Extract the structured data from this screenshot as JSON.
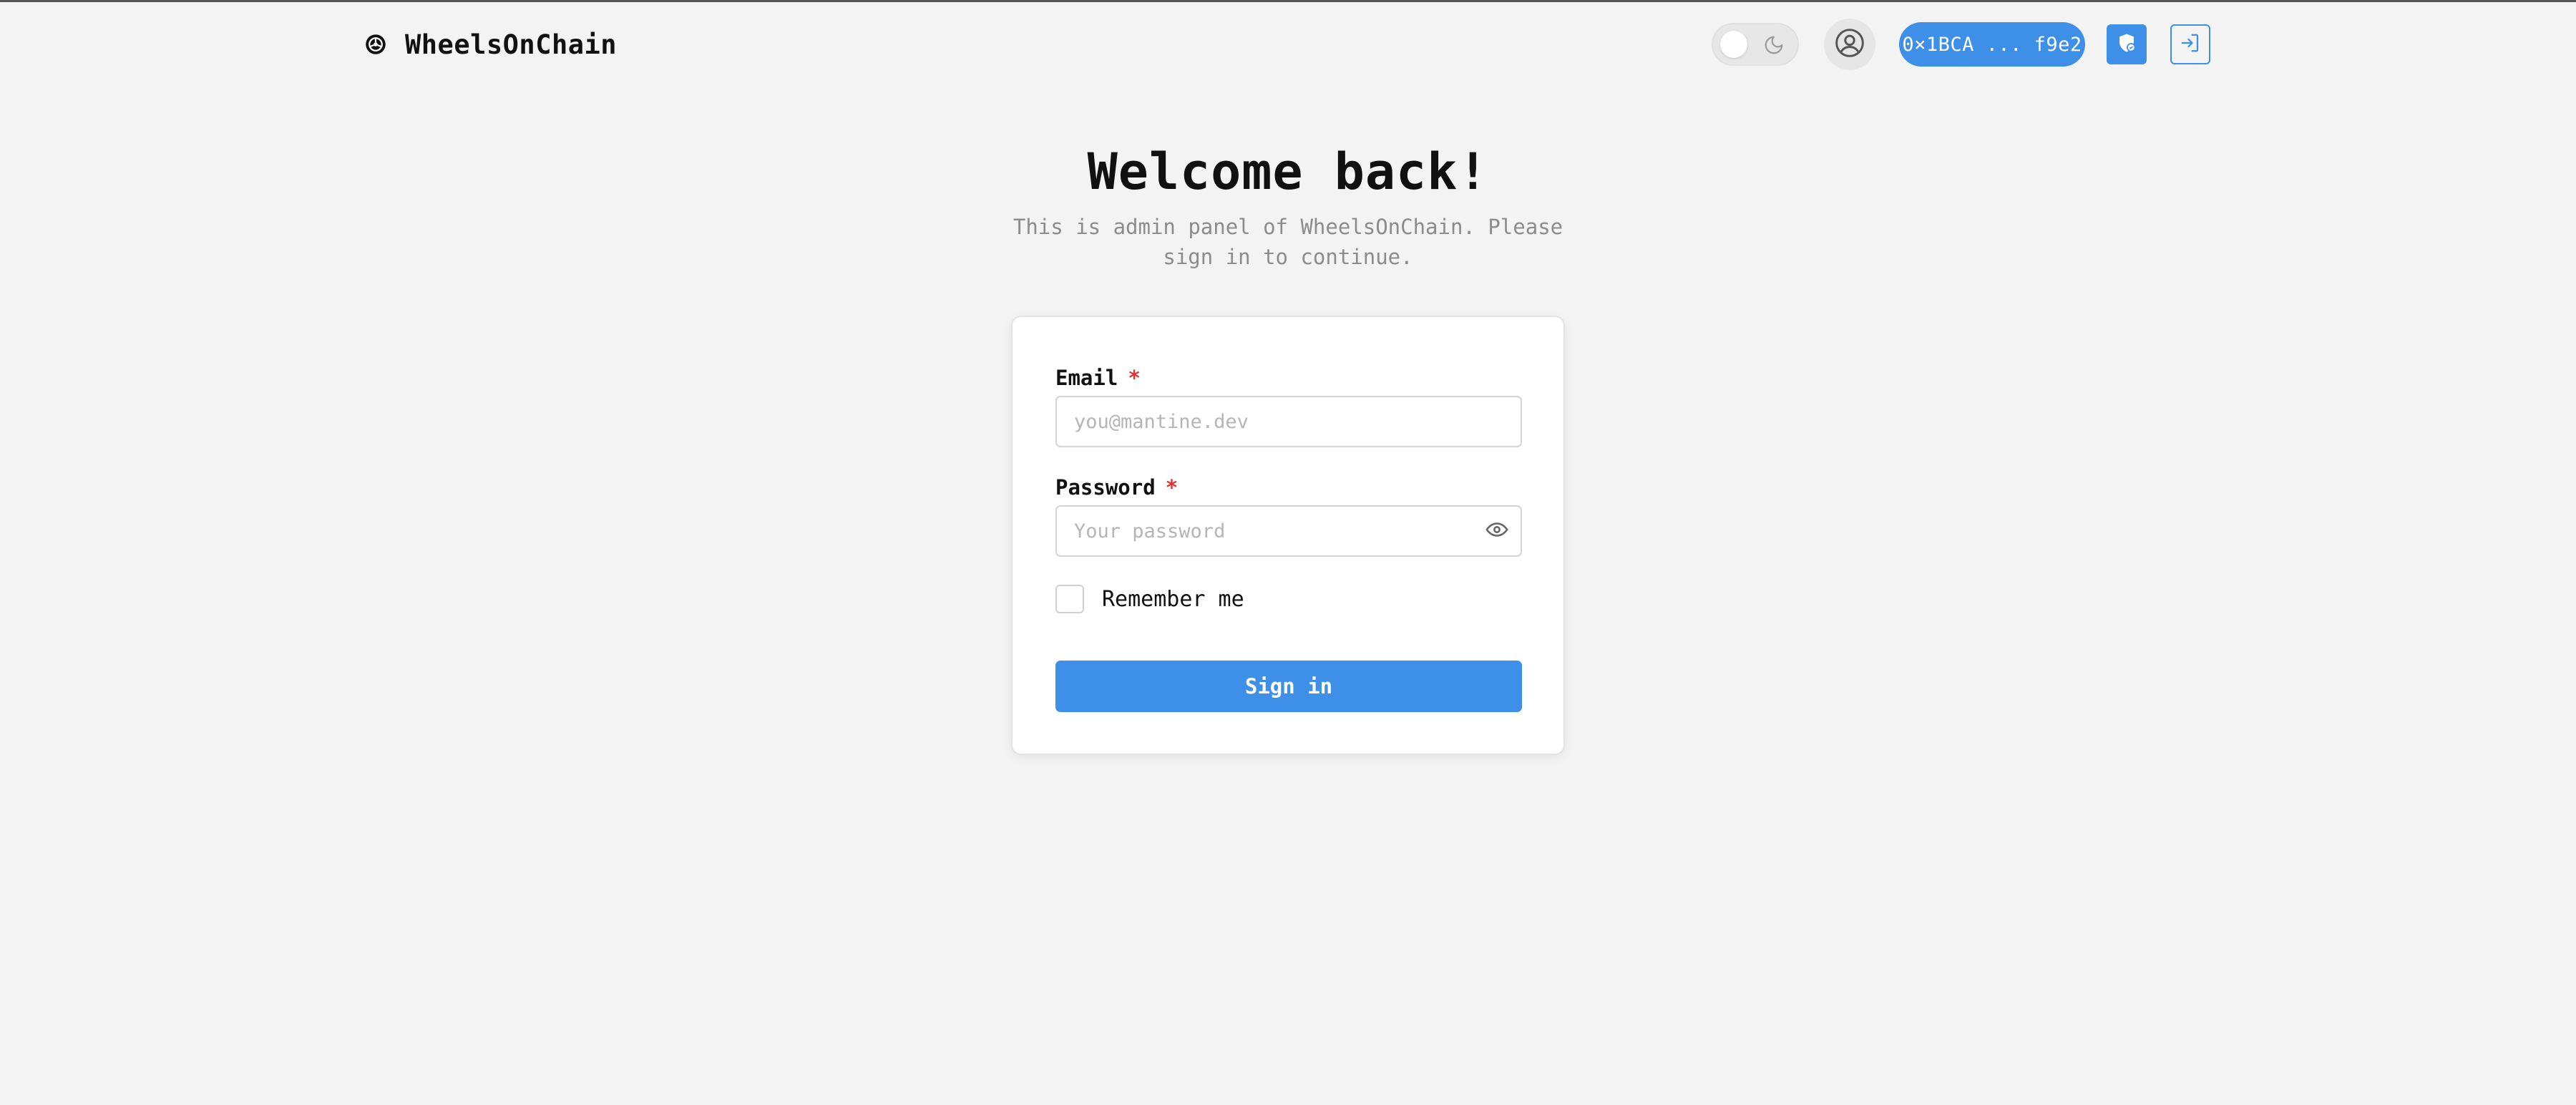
{
  "header": {
    "brand_name": "WheelsOnChain",
    "brand_icon": "steering-wheel-icon",
    "theme_toggle_icon": "moon-icon",
    "avatar_icon": "user-circle-icon",
    "wallet_label": "0×1BCA ... f9e2",
    "filled_button_icon": "shield-check-icon",
    "outline_button_icon": "login-icon"
  },
  "hero": {
    "title": "Welcome back!",
    "subtitle": "This is admin panel of WheelsOnChain. Please sign in to continue."
  },
  "form": {
    "email_label": "Email",
    "email_placeholder": "you@mantine.dev",
    "password_label": "Password",
    "password_placeholder": "Your password",
    "required_mark": "*",
    "remember_label": "Remember me",
    "submit_label": "Sign in"
  },
  "colors": {
    "accent": "#3d8fe8",
    "background": "#f3f3f3",
    "required": "#e03131",
    "muted_text": "#8c8c8c"
  }
}
